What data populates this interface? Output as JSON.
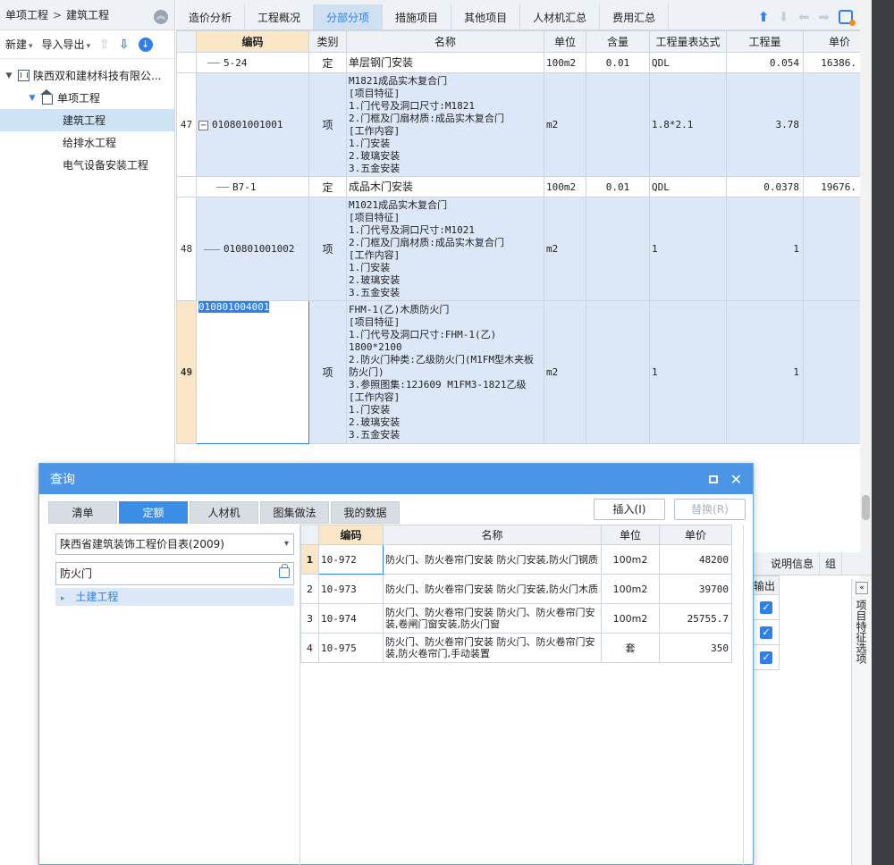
{
  "sidebar": {
    "breadcrumb": [
      "单项工程",
      "建筑工程"
    ],
    "toolbar": {
      "new_label": "新建",
      "import_export_label": "导入导出"
    },
    "tree": {
      "company": "陕西双和建材科技有限公...",
      "project": "单项工程",
      "items": [
        "建筑工程",
        "给排水工程",
        "电气设备安装工程"
      ]
    }
  },
  "tabs": [
    "造价分析",
    "工程概况",
    "分部分项",
    "措施项目",
    "其他项目",
    "人材机汇总",
    "费用汇总"
  ],
  "grid": {
    "headers": [
      "编码",
      "类别",
      "名称",
      "单位",
      "含量",
      "工程量表达式",
      "工程量",
      "单价"
    ],
    "rows": [
      {
        "rn": "",
        "code": "5-24",
        "type": "定",
        "name": "单层钢门安装",
        "unit": "100m2",
        "content": "0.01",
        "expr": "QDL",
        "qty": "0.054",
        "price": "16386."
      },
      {
        "rn": "47",
        "code": "010801001001",
        "type": "项",
        "name": "M1821成品实木复合门\n[项目特征]\n1.门代号及洞口尺寸:M1821\n2.门框及门扇材质:成品实木复合门\n[工作内容]\n1.门安装\n2.玻璃安装\n3.五金安装",
        "unit": "m2",
        "content": "",
        "expr": "1.8*2.1",
        "qty": "3.78",
        "price": ""
      },
      {
        "rn": "",
        "code": "B7-1",
        "type": "定",
        "name": "成品木门安装",
        "unit": "100m2",
        "content": "0.01",
        "expr": "QDL",
        "qty": "0.0378",
        "price": "19676."
      },
      {
        "rn": "48",
        "code": "010801001002",
        "type": "项",
        "name": "M1021成品实木复合门\n[项目特征]\n1.门代号及洞口尺寸:M1021\n2.门框及门扇材质:成品实木复合门\n[工作内容]\n1.门安装\n2.玻璃安装\n3.五金安装",
        "unit": "m2",
        "content": "",
        "expr": "1",
        "qty": "1",
        "price": ""
      },
      {
        "rn": "49",
        "code": "010801004001",
        "type": "项",
        "name": "FHM-1(乙)木质防火门\n[项目特征]\n1.门代号及洞口尺寸:FHM-1(乙)\n1800*2100\n2.防火门种类:乙级防火门(M1FM型木夹板防火门)\n3.参照图集:12J609 M1FM3-1821乙级\n[工作内容]\n1.门安装\n2.玻璃安装\n3.五金安装",
        "unit": "m2",
        "content": "",
        "expr": "1",
        "qty": "1",
        "price": ""
      }
    ]
  },
  "lower_panel": {
    "tabs": [
      "说明信息",
      "组"
    ],
    "output_header": "输出",
    "vertical_label": "项目特征选项"
  },
  "dialog": {
    "title": "查询",
    "tabs": [
      "清单",
      "定额",
      "人材机",
      "图集做法",
      "我的数据"
    ],
    "active_tab": "定额",
    "insert_label": "插入(I)",
    "replace_label": "替换(R)",
    "library": "陕西省建筑装饰工程价目表(2009)",
    "keyword": "防火门",
    "category": "土建工程",
    "results_headers": [
      "编码",
      "名称",
      "单位",
      "单价"
    ],
    "results": [
      {
        "rn": "1",
        "code": "10-972",
        "name": "防火门、防火卷帘门安装 防火门安装,防火门钢质",
        "unit": "100m2",
        "price": "48200"
      },
      {
        "rn": "2",
        "code": "10-973",
        "name": "防火门、防火卷帘门安装 防火门安装,防火门木质",
        "unit": "100m2",
        "price": "39700"
      },
      {
        "rn": "3",
        "code": "10-974",
        "name": "防火门、防火卷帘门安装 防火门、防火卷帘门安装,卷闸门窗安装,防火门窗",
        "unit": "100m2",
        "price": "25755.7"
      },
      {
        "rn": "4",
        "code": "10-975",
        "name": "防火门、防火卷帘门安装 防火门、防火卷帘门安装,防火卷帘门,手动装置",
        "unit": "套",
        "price": "350"
      }
    ]
  },
  "colors": {
    "accent": "#2f80ed",
    "dialog_title": "#4a95e6",
    "selected_row": "#dce8f8",
    "header_highlight": "#fbe7c7"
  }
}
